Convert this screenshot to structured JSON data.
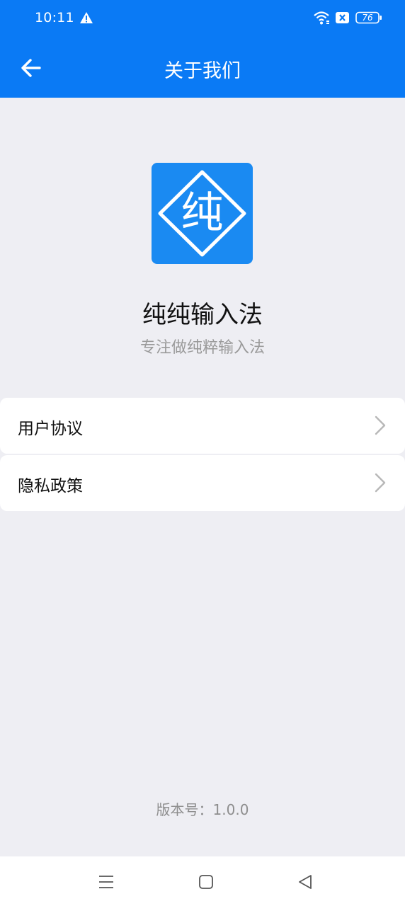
{
  "status_bar": {
    "time": "10:11",
    "battery": "76",
    "icons": [
      "alert-icon",
      "wifi-icon",
      "sim-off-icon",
      "battery-icon"
    ]
  },
  "app_bar": {
    "title": "关于我们",
    "back_icon": "arrow-left-icon"
  },
  "about": {
    "logo_char": "纯",
    "app_name": "纯纯输入法",
    "slogan": "专注做纯粹输入法"
  },
  "menu": [
    {
      "label": "用户协议",
      "icon": "chevron-right-icon"
    },
    {
      "label": "隐私政策",
      "icon": "chevron-right-icon"
    }
  ],
  "footer": {
    "version": "版本号：1.0.0"
  },
  "colors": {
    "primary": "#0A7AF5",
    "background": "#EEEEF3",
    "logo": "#1A8AF2"
  },
  "nav_bar": {
    "icons": [
      "menu-lines-icon",
      "home-square-icon",
      "back-triangle-icon"
    ]
  }
}
